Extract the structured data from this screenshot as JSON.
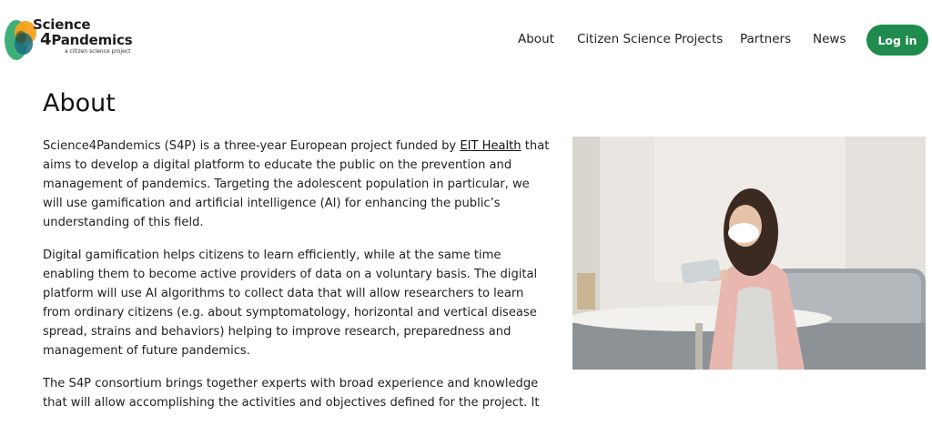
{
  "brand": {
    "line1": "Science",
    "line2_num": "4",
    "line2_text": "Pandemics",
    "tagline": "a citizen science project"
  },
  "nav": {
    "items": [
      "About",
      "Citizen Science Projects",
      "Partners",
      "News"
    ],
    "login": "Log in"
  },
  "colors": {
    "accent": "#1f8b4c"
  },
  "page": {
    "title": "About",
    "p1_before": "Science4Pandemics (S4P) is a three-year European project funded by ",
    "p1_link": "EIT Health",
    "p1_after": " that aims to develop a digital platform to educate the public on the prevention and management of pandemics. Targeting the adolescent population in particular, we will use gamification and artificial intelligence (AI) for enhancing the public’s understanding of this field.",
    "p2": "Digital gamification helps citizens to learn efficiently, while at the same time enabling them to become active providers of data on a voluntary basis. The digital platform will use AI algorithms to collect data that will allow researchers to learn from ordinary citizens (e.g. about symptomatology, horizontal and vertical disease spread, strains and behaviors) helping to improve research, preparedness and management of future pandemics.",
    "p3": "The S4P consortium brings together experts with broad experience and knowledge that will allow accomplishing the activities and objectives defined for the project. It"
  }
}
